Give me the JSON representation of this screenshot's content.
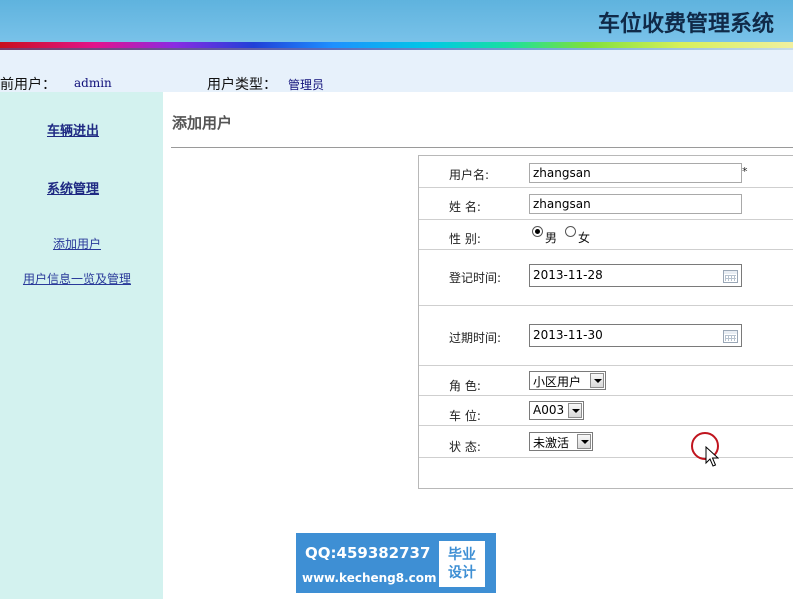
{
  "app": {
    "title": "车位收费管理系统"
  },
  "userbar": {
    "current_user_label": "当前用户：",
    "current_user_value": "admin",
    "user_type_label": "用户类型：",
    "user_type_value": "管理员"
  },
  "sidebar": {
    "items": [
      {
        "label": "车辆进出",
        "style": "bold"
      },
      {
        "label": "系统管理",
        "style": "bold"
      },
      {
        "label": "添加用户",
        "style": "normal"
      },
      {
        "label": "用户信息一览及管理",
        "style": "normal"
      }
    ]
  },
  "page": {
    "title": "添加用户"
  },
  "form": {
    "username": {
      "label": "用户名:",
      "value": "zhangsan",
      "required_mark": "*"
    },
    "name": {
      "label": "姓 名:",
      "value": "zhangsan"
    },
    "gender": {
      "label": "性 别:",
      "options": [
        "男",
        "女"
      ],
      "selected": "男"
    },
    "register_time": {
      "label": "登记时间:",
      "value": "2013-11-28"
    },
    "expire_time": {
      "label": "过期时间:",
      "value": "2013-11-30"
    },
    "role": {
      "label": "角 色:",
      "value": "小区用户"
    },
    "parking_space": {
      "label": "车 位:",
      "value": "A003"
    },
    "status": {
      "label": "状 态:",
      "value": "未激活"
    }
  },
  "watermark": {
    "qq": "QQ:459382737",
    "url": "www.kecheng8.com",
    "badge_line1": "毕业",
    "badge_line2": "设计"
  },
  "colors": {
    "banner": "#6cb9e3",
    "sidebar": "#d3f2ef",
    "userbar": "#e7f1fb",
    "link": "#1f2a83",
    "cursor_ring": "#c0141e"
  }
}
